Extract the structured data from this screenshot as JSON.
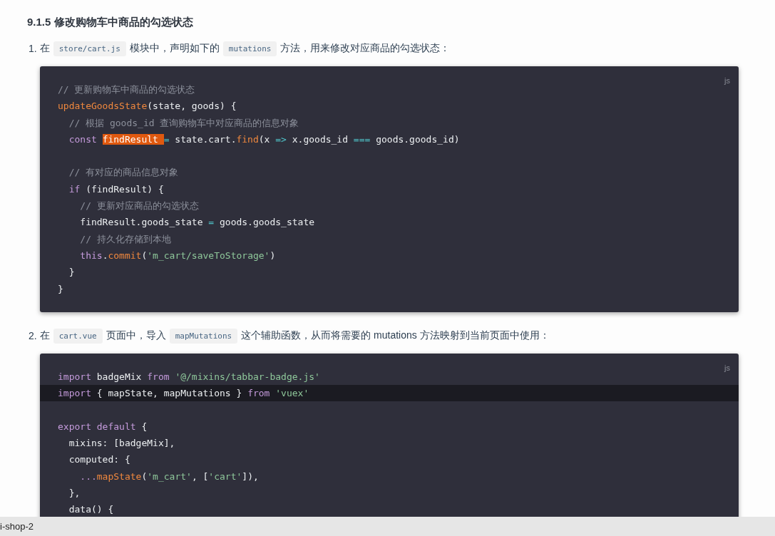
{
  "heading": "9.1.5 修改购物车中商品的勾选状态",
  "steps": [
    {
      "number": "1.",
      "text": [
        {
          "kind": "text",
          "t": "在"
        },
        {
          "kind": "code",
          "t": "store/cart.js"
        },
        {
          "kind": "text",
          "t": "模块中，声明如下的"
        },
        {
          "kind": "code",
          "t": "mutations"
        },
        {
          "kind": "text",
          "t": "方法，用来修改对应商品的勾选状态："
        }
      ],
      "code_block": {
        "language": "js",
        "lines": [
          {
            "highlighted": false,
            "tokens": [
              {
                "kind": "com",
                "t": "// 更新购物车中商品的勾选状态"
              }
            ]
          },
          {
            "highlighted": false,
            "tokens": [
              {
                "kind": "fn",
                "t": "updateGoodsState"
              },
              {
                "kind": "p",
                "t": "(state, goods) {"
              }
            ]
          },
          {
            "highlighted": false,
            "tokens": [
              {
                "kind": "com",
                "t": "  // 根据 goods_id 查询购物车中对应商品的信息对象"
              }
            ]
          },
          {
            "highlighted": false,
            "tokens": [
              {
                "kind": "kw",
                "t": "  const "
              },
              {
                "kind": "sel",
                "t": "findResult "
              },
              {
                "kind": "op",
                "t": "="
              },
              {
                "kind": "p",
                "t": " state.cart."
              },
              {
                "kind": "fn",
                "t": "find"
              },
              {
                "kind": "p",
                "t": "(x "
              },
              {
                "kind": "op",
                "t": "=>"
              },
              {
                "kind": "p",
                "t": " x.goods_id "
              },
              {
                "kind": "op",
                "t": "==="
              },
              {
                "kind": "p",
                "t": " goods.goods_id)"
              }
            ]
          },
          {
            "highlighted": false,
            "blank_line_before": true,
            "tokens": [
              {
                "kind": "com",
                "t": "  // 有对应的商品信息对象"
              }
            ]
          },
          {
            "highlighted": false,
            "tokens": [
              {
                "kind": "kw",
                "t": "  if"
              },
              {
                "kind": "p",
                "t": " (findResult) {"
              }
            ]
          },
          {
            "highlighted": false,
            "tokens": [
              {
                "kind": "com",
                "t": "    // 更新对应商品的勾选状态"
              }
            ]
          },
          {
            "highlighted": false,
            "tokens": [
              {
                "kind": "p",
                "t": "    findResult.goods_state "
              },
              {
                "kind": "op",
                "t": "="
              },
              {
                "kind": "p",
                "t": " goods.goods_state"
              }
            ]
          },
          {
            "highlighted": false,
            "tokens": [
              {
                "kind": "com",
                "t": "    // 持久化存储到本地"
              }
            ]
          },
          {
            "highlighted": false,
            "tokens": [
              {
                "kind": "kw",
                "t": "    this"
              },
              {
                "kind": "p",
                "t": "."
              },
              {
                "kind": "fn",
                "t": "commit"
              },
              {
                "kind": "p",
                "t": "("
              },
              {
                "kind": "str",
                "t": "'m_cart/saveToStorage'"
              },
              {
                "kind": "p",
                "t": ")"
              }
            ]
          },
          {
            "highlighted": false,
            "tokens": [
              {
                "kind": "p",
                "t": "  }"
              }
            ]
          },
          {
            "highlighted": false,
            "tokens": [
              {
                "kind": "p",
                "t": "}"
              }
            ]
          }
        ]
      }
    },
    {
      "number": "2.",
      "text": [
        {
          "kind": "text",
          "t": "在"
        },
        {
          "kind": "code",
          "t": "cart.vue"
        },
        {
          "kind": "text",
          "t": "页面中，导入"
        },
        {
          "kind": "code",
          "t": "mapMutations"
        },
        {
          "kind": "text",
          "t": "这个辅助函数，从而将需要的 mutations 方法映射到当前页面中使用："
        }
      ],
      "code_block": {
        "language": "js",
        "lines": [
          {
            "highlighted": false,
            "tokens": [
              {
                "kind": "kw",
                "t": "import"
              },
              {
                "kind": "p",
                "t": " badgeMix "
              },
              {
                "kind": "kw",
                "t": "from"
              },
              {
                "kind": "str",
                "t": " '@/mixins/tabbar-badge.js'"
              }
            ]
          },
          {
            "highlighted": true,
            "tokens": [
              {
                "kind": "kw",
                "t": "import"
              },
              {
                "kind": "p",
                "t": " { mapState, mapMutations } "
              },
              {
                "kind": "kw",
                "t": "from"
              },
              {
                "kind": "str",
                "t": " 'vuex'"
              }
            ]
          },
          {
            "highlighted": false,
            "blank_line_before": true,
            "tokens": [
              {
                "kind": "kw",
                "t": "export default"
              },
              {
                "kind": "p",
                "t": " {"
              }
            ]
          },
          {
            "highlighted": false,
            "tokens": [
              {
                "kind": "p",
                "t": "  mixins: [badgeMix],"
              }
            ]
          },
          {
            "highlighted": false,
            "tokens": [
              {
                "kind": "p",
                "t": "  computed: {"
              }
            ]
          },
          {
            "highlighted": false,
            "tokens": [
              {
                "kind": "kw",
                "t": "    ..."
              },
              {
                "kind": "fn",
                "t": "mapState"
              },
              {
                "kind": "p",
                "t": "("
              },
              {
                "kind": "str",
                "t": "'m_cart'"
              },
              {
                "kind": "p",
                "t": ", ["
              },
              {
                "kind": "str",
                "t": "'cart'"
              },
              {
                "kind": "p",
                "t": "]),"
              }
            ]
          },
          {
            "highlighted": false,
            "tokens": [
              {
                "kind": "p",
                "t": "  },"
              }
            ]
          },
          {
            "highlighted": false,
            "tokens": [
              {
                "kind": "p",
                "t": "  data() {"
              }
            ]
          }
        ]
      }
    }
  ],
  "status_bar": {
    "text": "i-shop-2"
  }
}
